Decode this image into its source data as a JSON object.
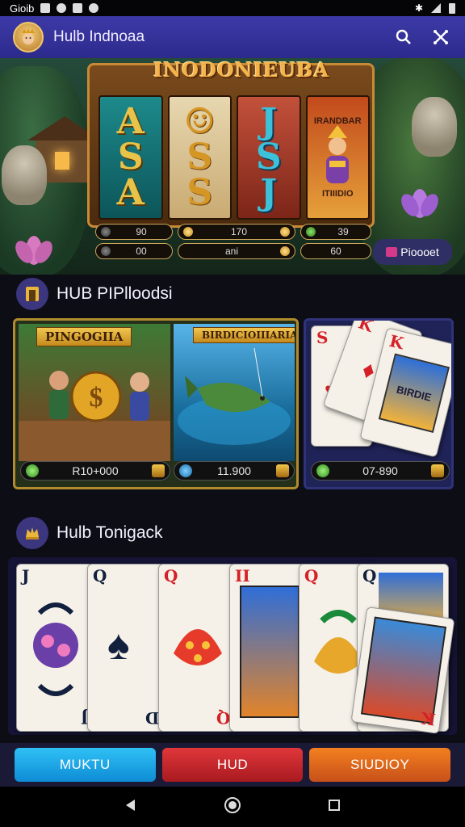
{
  "status_bar": {
    "left_text": "Gioib"
  },
  "app_bar": {
    "title": "Hulb Indnoaa"
  },
  "hero": {
    "title": "INODONIEUBA",
    "reels": [
      {
        "symbols": [
          "A",
          "S",
          "A"
        ]
      },
      {
        "symbols": [
          "☺",
          "S",
          "S"
        ]
      },
      {
        "symbols": [
          "J",
          "S",
          "J"
        ]
      },
      {
        "top_label": "IRANDBAR",
        "bottom_label": "ITIIIDIO"
      }
    ],
    "row1": [
      "90",
      "170",
      "39"
    ],
    "row2": [
      "00",
      "ani",
      "60"
    ],
    "promo_label": "Pioooet"
  },
  "section1": {
    "title": "HUB PIPlloodsi"
  },
  "games": {
    "tile1_label": "PINGOGIIA",
    "tile2_label": "BIRDICIOIIIARIA",
    "card_panel_label": "BIRDIE",
    "value1": "R10+000",
    "value2": "11.900",
    "value3": "07-890"
  },
  "section2": {
    "title": "Hulb Tonigack"
  },
  "tabs": [
    "MUKTU",
    "HUD",
    "SIUDIOY"
  ],
  "colors": {
    "appbar": "#3d3aa8",
    "accent_gold": "#c98a36",
    "tab_blue": "#0e8bd4",
    "tab_red": "#d62027",
    "tab_orange": "#f3801f"
  }
}
